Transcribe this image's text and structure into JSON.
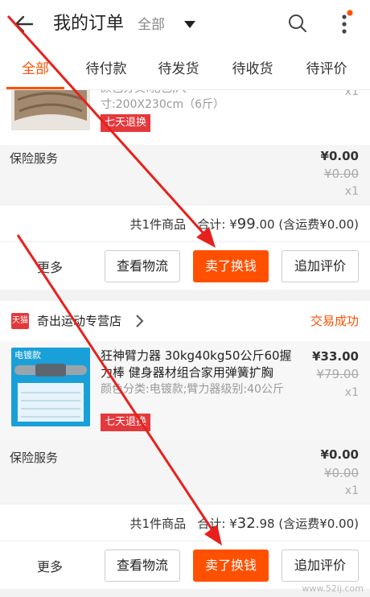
{
  "header": {
    "title": "我的订单",
    "scope": "全部",
    "icons": [
      "back-arrow-icon",
      "caret-down-icon",
      "search-icon",
      "more-vertical-icon"
    ],
    "accent": "#ff5000"
  },
  "tabs": [
    {
      "label": "全部",
      "active": true
    },
    {
      "label": "待付款",
      "active": false
    },
    {
      "label": "待发货",
      "active": false
    },
    {
      "label": "待收货",
      "active": false
    },
    {
      "label": "待评价",
      "active": false
    }
  ],
  "order1": {
    "product": {
      "attr_partial": "颜色分类:驼色,尺",
      "attr": "寸:200X230cm（6斤）",
      "tag": "七天退换",
      "qty": "x1"
    },
    "insurance": {
      "label": "保险服务",
      "price": "¥0.00",
      "orig": "¥0.00",
      "qty": "x1"
    },
    "summary": {
      "count": "共1件商品",
      "total_label": "合计:",
      "currency": "¥",
      "total_int": "99",
      "total_dec": ".00",
      "shipping": "(含运费¥0.00)"
    },
    "actions": {
      "more": "更多",
      "logistics": "查看物流",
      "sell": "卖了换钱",
      "review": "追加评价"
    }
  },
  "order2": {
    "store": {
      "logo_text": "天猫",
      "name": "奇出运动专营店",
      "status": "交易成功"
    },
    "product": {
      "thumb_text": "电镀款",
      "title": "狂神臂力器 30kg40kg50公斤60握力棒 健身器材组合家用弹簧扩胸",
      "attr": "颜色分类:电镀款;臂力器级别:40公斤",
      "tag": "七天退换",
      "price": "¥33.00",
      "orig": "¥79.00",
      "qty": "x1"
    },
    "insurance": {
      "label": "保险服务",
      "price": "¥0.00",
      "orig": "¥0.00",
      "qty": "x1"
    },
    "summary": {
      "count": "共1件商品",
      "total_label": "合计:",
      "currency": "¥",
      "total_int": "32",
      "total_dec": ".98",
      "shipping": "(含运费¥0.00)"
    },
    "actions": {
      "more": "更多",
      "logistics": "查看物流",
      "sell": "卖了换钱",
      "review": "追加评价"
    }
  },
  "watermark": "www.52ij.com"
}
